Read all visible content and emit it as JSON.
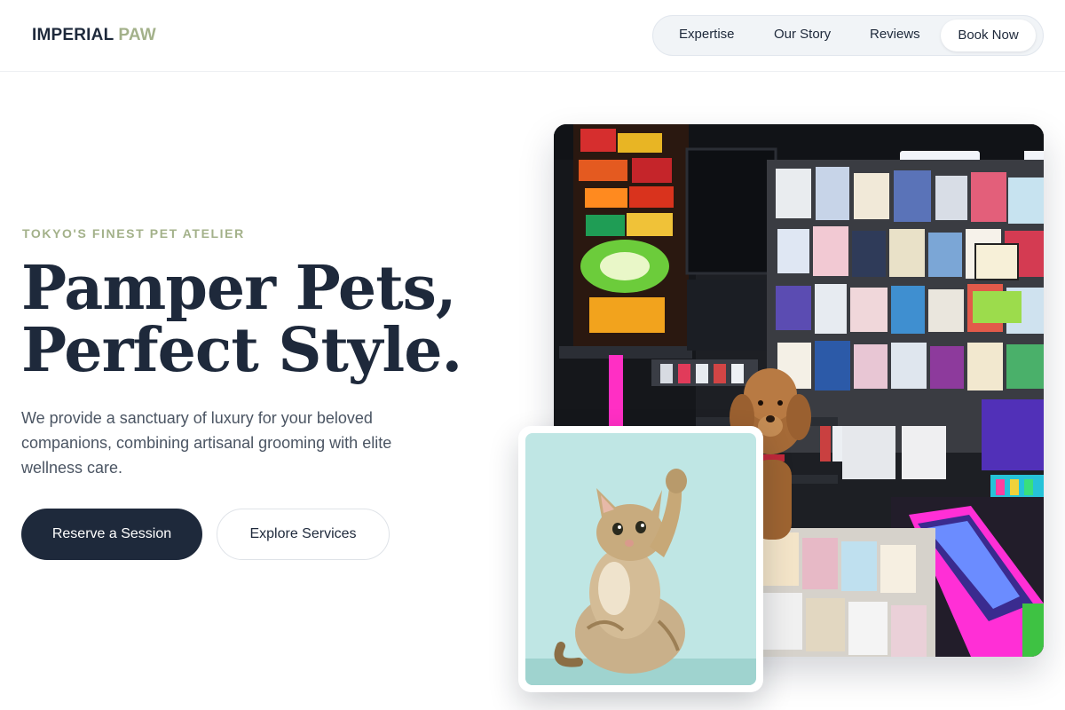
{
  "brand": {
    "name_main": "IMPERIAL",
    "name_accent": "PAW",
    "accent_color": "#a3b18a",
    "text_color": "#1e293b"
  },
  "nav": {
    "items": [
      {
        "label": "Expertise"
      },
      {
        "label": "Our Story"
      },
      {
        "label": "Reviews"
      }
    ],
    "cta_label": "Book Now"
  },
  "hero": {
    "eyebrow": "TOKYO'S FINEST PET ATELIER",
    "headline_line1": "Pamper Pets,",
    "headline_line2": "Perfect Style.",
    "description": "We provide a sanctuary of luxury for your beloved companions, combining artisanal grooming with elite wellness care.",
    "primary_button": "Reserve a Session",
    "secondary_button": "Explore Services"
  },
  "images": {
    "main_photo": "poodle-in-convenience-store-photo",
    "card_photo": "kitten-raising-paw-photo"
  }
}
